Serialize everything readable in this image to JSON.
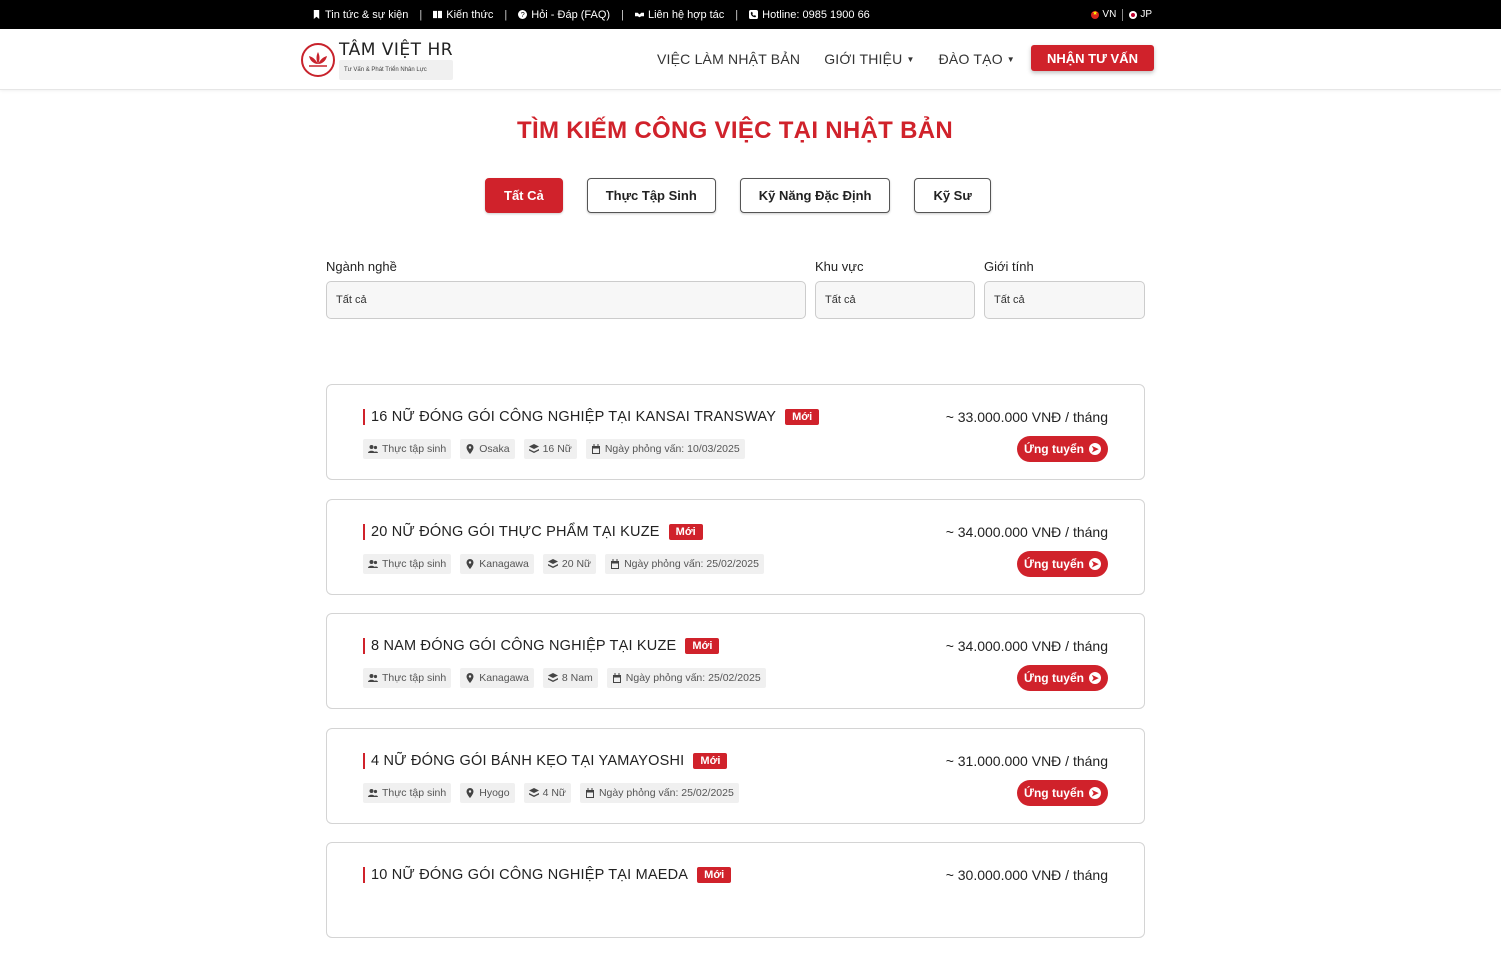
{
  "topbar": {
    "links": [
      {
        "icon": "bookmark-icon",
        "label": "Tin tức & sự kiện"
      },
      {
        "icon": "book-icon",
        "label": "Kiến thức"
      },
      {
        "icon": "question-circle-icon",
        "label": "Hỏi - Đáp (FAQ)"
      },
      {
        "icon": "handshake-icon",
        "label": "Liên hệ hợp tác"
      },
      {
        "icon": "phone-icon",
        "label": "Hotline: 0985 1900 66"
      }
    ],
    "languages": [
      "VN",
      "JP"
    ]
  },
  "header": {
    "logo_name": "TÂM VIỆT HR",
    "logo_tagline": "Tư Vấn & Phát Triển Nhân Lực",
    "nav": [
      "VIỆC LÀM NHẬT BẢN",
      "GIỚI THIỆU",
      "ĐÀO TẠO"
    ],
    "cta": "NHẬN TƯ VẤN"
  },
  "page_title": "TÌM KIẾM CÔNG VIỆC TẠI NHẬT BẢN",
  "tabs": [
    "Tất Cả",
    "Thực Tập Sinh",
    "Kỹ Năng Đặc Định",
    "Kỹ Sư"
  ],
  "active_tab": "Tất Cả",
  "filters": {
    "industry": {
      "label": "Ngành nghề",
      "value": "Tất cả"
    },
    "region": {
      "label": "Khu vực",
      "value": "Tất cả"
    },
    "gender": {
      "label": "Giới tính",
      "value": "Tất cả"
    }
  },
  "jobs": [
    {
      "title": "16 NỮ ĐÓNG GÓI CÔNG NGHIỆP TẠI KANSAI TRANSWAY",
      "badge": "Mới",
      "type": "Thực tập sinh",
      "location": "Osaka",
      "count": "16 Nữ",
      "interview": "Ngày phỏng vấn: 10/03/2025",
      "salary": "~ 33.000.000 VNĐ / tháng",
      "apply": "Ứng tuyển"
    },
    {
      "title": "20 NỮ ĐÓNG GÓI THỰC PHẨM TẠI KUZE",
      "badge": "Mới",
      "type": "Thực tập sinh",
      "location": "Kanagawa",
      "count": "20 Nữ",
      "interview": "Ngày phỏng vấn: 25/02/2025",
      "salary": "~ 34.000.000 VNĐ / tháng",
      "apply": "Ứng tuyển"
    },
    {
      "title": "8 NAM ĐÓNG GÓI CÔNG NGHIỆP TẠI KUZE",
      "badge": "Mới",
      "type": "Thực tập sinh",
      "location": "Kanagawa",
      "count": "8 Nam",
      "interview": "Ngày phỏng vấn: 25/02/2025",
      "salary": "~ 34.000.000 VNĐ / tháng",
      "apply": "Ứng tuyển"
    },
    {
      "title": "4 NỮ ĐÓNG GÓI BÁNH KẸO TẠI YAMAYOSHI",
      "badge": "Mới",
      "type": "Thực tập sinh",
      "location": "Hyogo",
      "count": "4 Nữ",
      "interview": "Ngày phỏng vấn: 25/02/2025",
      "salary": "~ 31.000.000 VNĐ / tháng",
      "apply": "Ứng tuyển"
    },
    {
      "title": "10 NỮ ĐÓNG GÓI CÔNG NGHIỆP TẠI MAEDA",
      "badge": "Mới",
      "salary": "~ 30.000.000 VNĐ / tháng"
    }
  ],
  "colors": {
    "accent": "#d0222b",
    "topbar": "#000000"
  }
}
